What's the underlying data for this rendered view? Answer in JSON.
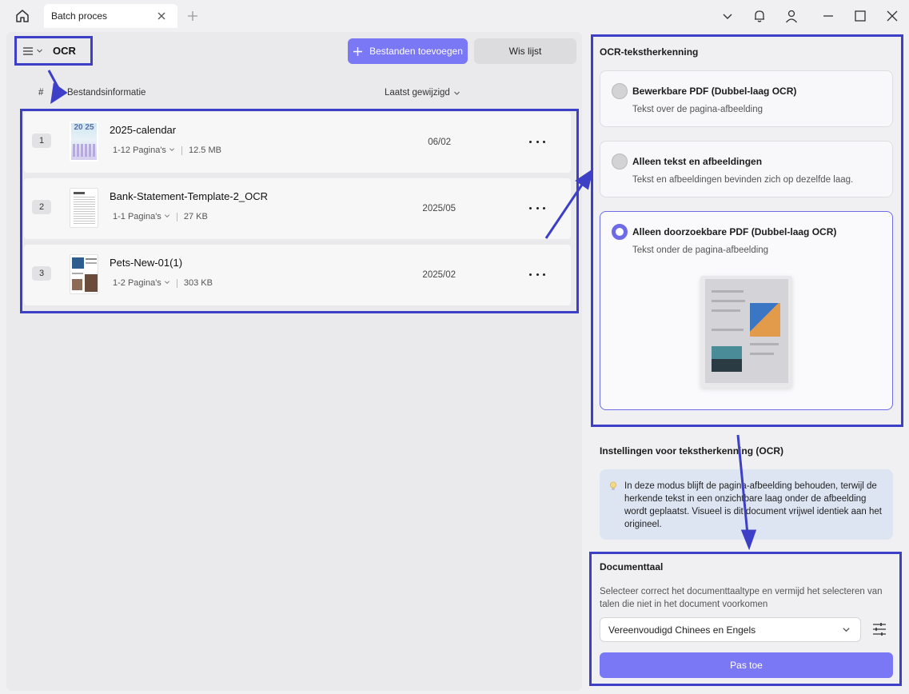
{
  "tab": {
    "title": "Batch proces"
  },
  "header": {
    "title": "OCR",
    "add_label": "Bestanden toevoegen",
    "clear_label": "Wis lijst"
  },
  "columns": {
    "num": "#",
    "info": "Bestandsinformatie",
    "modified": "Laatst gewijzigd"
  },
  "files": [
    {
      "num": "1",
      "name": "2025-calendar",
      "pages": "1-12 Pagina's",
      "size": "12.5 MB",
      "date": "06/02"
    },
    {
      "num": "2",
      "name": "Bank-Statement-Template-2_OCR",
      "pages": "1-1 Pagina's",
      "size": "27 KB",
      "date": "2025/05"
    },
    {
      "num": "3",
      "name": "Pets-New-01(1)",
      "pages": "1-2 Pagina's",
      "size": "303 KB",
      "date": "2025/02"
    }
  ],
  "thumb_text": {
    "calendar": "20 25"
  },
  "ocr": {
    "title": "OCR-tekstherkenning",
    "options": [
      {
        "title": "Bewerkbare PDF (Dubbel-laag OCR)",
        "desc": "Tekst over de pagina-afbeelding",
        "selected": false
      },
      {
        "title": "Alleen tekst en afbeeldingen",
        "desc": "Tekst en afbeeldingen bevinden zich op dezelfde laag.",
        "selected": false
      },
      {
        "title": "Alleen doorzoekbare PDF (Dubbel-laag OCR)",
        "desc": "Tekst onder de pagina-afbeelding",
        "selected": true
      }
    ]
  },
  "settings": {
    "title": "Instellingen voor tekstherkenning (OCR)",
    "info": "In deze modus blijft de pagina-afbeelding behouden, terwijl de herkende tekst in een onzichtbare laag onder de afbeelding wordt geplaatst. Visueel is dit document vrijwel identiek aan het origineel."
  },
  "language": {
    "title": "Documenttaal",
    "desc": "Selecteer correct het documenttaaltype en vermijd het selecteren van talen die niet in het document voorkomen",
    "selected": "Vereenvoudigd Chinees en Engels",
    "apply_label": "Pas toe"
  },
  "colors": {
    "accent": "#7b78f5",
    "annotation": "#3d3fc6"
  },
  "icons": [
    "home-icon",
    "close-icon",
    "plus-icon",
    "chevron-down-icon",
    "bell-icon",
    "user-icon",
    "minimize-icon",
    "maximize-icon",
    "hamburger-icon",
    "more-icon",
    "bulb-icon",
    "sliders-icon"
  ]
}
